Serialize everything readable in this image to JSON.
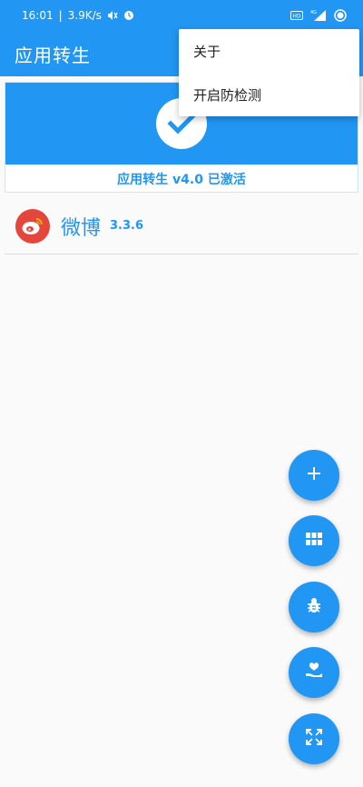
{
  "status_bar": {
    "time": "16:01",
    "speed": "3.9K/s",
    "icons": [
      "mute-icon",
      "alarm-icon",
      "hd-icon",
      "4g-signal-icon",
      "battery-icon"
    ]
  },
  "app_bar": {
    "title": "应用转生"
  },
  "menu": {
    "items": [
      {
        "label": "关于"
      },
      {
        "label": "开启防检测"
      }
    ]
  },
  "status_card": {
    "icon": "check-icon",
    "label": "应用转生 v4.0 已激活"
  },
  "apps": [
    {
      "name": "微博",
      "version": "3.3.6",
      "icon": "weibo-icon"
    }
  ],
  "fabs": [
    "add-icon",
    "grid-icon",
    "bug-icon",
    "donate-icon",
    "fullscreen-icon"
  ],
  "colors": {
    "primary": "#2196f3",
    "background": "#fafafa",
    "weibo_red": "#e5463b"
  }
}
